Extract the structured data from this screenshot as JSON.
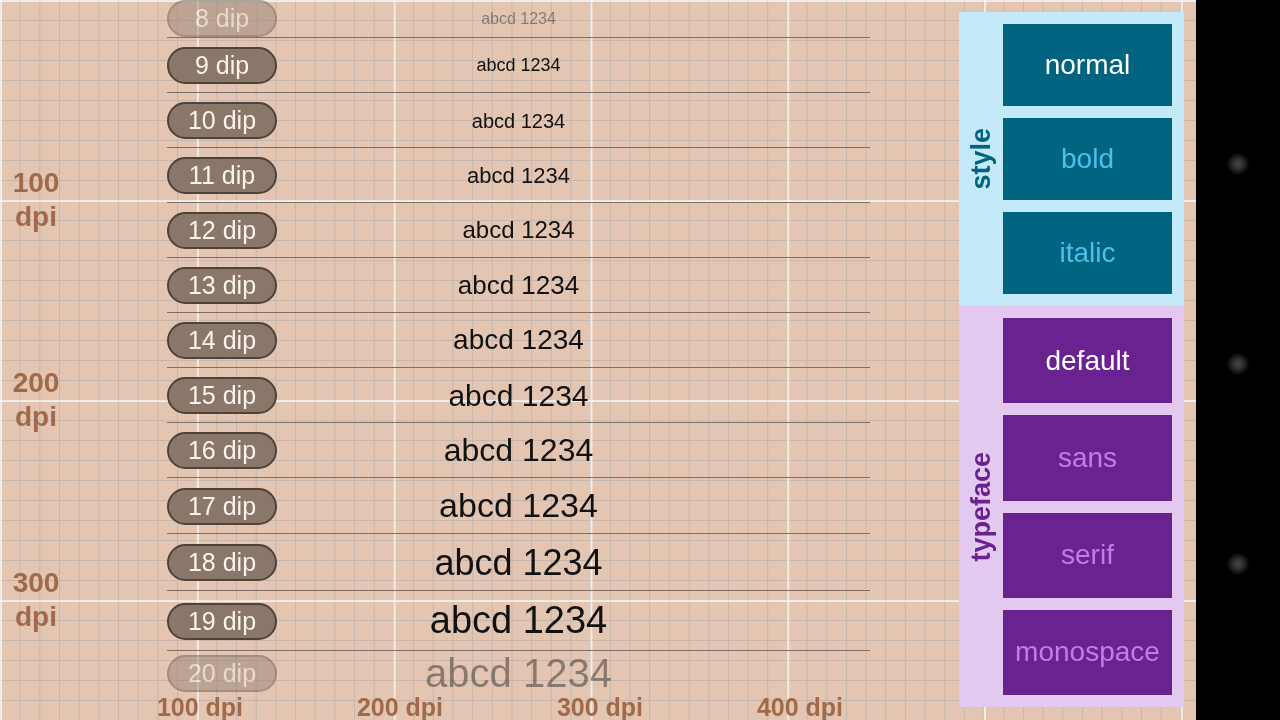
{
  "rows": [
    {
      "label": "8 dip",
      "sample": "abcd 1234",
      "faded": true
    },
    {
      "label": "9 dip",
      "sample": "abcd 1234",
      "faded": false
    },
    {
      "label": "10 dip",
      "sample": "abcd 1234",
      "faded": false
    },
    {
      "label": "11 dip",
      "sample": "abcd 1234",
      "faded": false
    },
    {
      "label": "12 dip",
      "sample": "abcd 1234",
      "faded": false
    },
    {
      "label": "13 dip",
      "sample": "abcd 1234",
      "faded": false
    },
    {
      "label": "14 dip",
      "sample": "abcd 1234",
      "faded": false
    },
    {
      "label": "15 dip",
      "sample": "abcd 1234",
      "faded": false
    },
    {
      "label": "16 dip",
      "sample": "abcd 1234",
      "faded": false
    },
    {
      "label": "17 dip",
      "sample": "abcd 1234",
      "faded": false
    },
    {
      "label": "18 dip",
      "sample": "abcd 1234",
      "faded": false
    },
    {
      "label": "19 dip",
      "sample": "abcd 1234",
      "faded": false
    },
    {
      "label": "20 dip",
      "sample": "abcd 1234",
      "faded": true
    }
  ],
  "ruler_left": [
    "100 dpi",
    "200 dpi",
    "300 dpi"
  ],
  "ruler_bottom": [
    "100 dpi",
    "200 dpi",
    "300 dpi",
    "400 dpi"
  ],
  "style_panel": {
    "title": "style",
    "options": [
      {
        "label": "normal",
        "selected": true
      },
      {
        "label": "bold",
        "selected": false
      },
      {
        "label": "italic",
        "selected": false
      }
    ]
  },
  "typeface_panel": {
    "title": "typeface",
    "options": [
      {
        "label": "default",
        "selected": true
      },
      {
        "label": "sans",
        "selected": false
      },
      {
        "label": "serif",
        "selected": false
      },
      {
        "label": "monospace",
        "selected": false
      }
    ]
  }
}
